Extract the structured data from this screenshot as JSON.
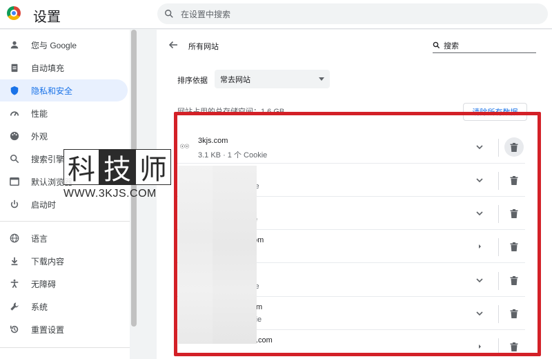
{
  "header": {
    "title": "设置",
    "search_placeholder": "在设置中搜索"
  },
  "sidebar": {
    "items": [
      {
        "label": "您与 Google",
        "icon": "person-icon"
      },
      {
        "label": "自动填充",
        "icon": "clipboard-icon"
      },
      {
        "label": "隐私和安全",
        "icon": "shield-icon",
        "active": true
      },
      {
        "label": "性能",
        "icon": "gauge-icon"
      },
      {
        "label": "外观",
        "icon": "palette-icon"
      },
      {
        "label": "搜索引擎",
        "icon": "search-icon"
      },
      {
        "label": "默认浏览器",
        "icon": "browser-icon"
      },
      {
        "label": "启动时",
        "icon": "power-icon"
      },
      {
        "label": "语言",
        "icon": "globe-icon"
      },
      {
        "label": "下载内容",
        "icon": "download-icon"
      },
      {
        "label": "无障碍",
        "icon": "accessibility-icon"
      },
      {
        "label": "系统",
        "icon": "wrench-icon"
      },
      {
        "label": "重置设置",
        "icon": "restore-icon"
      }
    ]
  },
  "subpage": {
    "title": "所有网站",
    "search_label": "搜索",
    "sort_label": "排序依据",
    "sort_value": "常去网站",
    "usage_text": "网站占用的总存储空间：1.6 GB",
    "clear_all": "清除所有数据"
  },
  "sites": [
    {
      "name": "3kjs.com",
      "detail": "3.1 KB · 1 个 Cookie",
      "expand": "chevron-down",
      "hover": true
    },
    {
      "name": "",
      "detail": "ie",
      "expand": "chevron-down"
    },
    {
      "name": "",
      "detail": "e",
      "expand": "chevron-down"
    },
    {
      "name": "om",
      "detail": "",
      "expand": "chevron-right"
    },
    {
      "name": "",
      "detail": "ie",
      "expand": "chevron-down"
    },
    {
      "name": "m",
      "detail": "okie",
      "expand": "chevron-down"
    },
    {
      "name": ".com",
      "detail": "",
      "expand": "chevron-right"
    }
  ],
  "watermark": {
    "chars": [
      "科",
      "技",
      "师"
    ],
    "url": "WWW.3KJS.COM"
  },
  "colors": {
    "accent": "#1a73e8",
    "highlight": "#d32027"
  }
}
